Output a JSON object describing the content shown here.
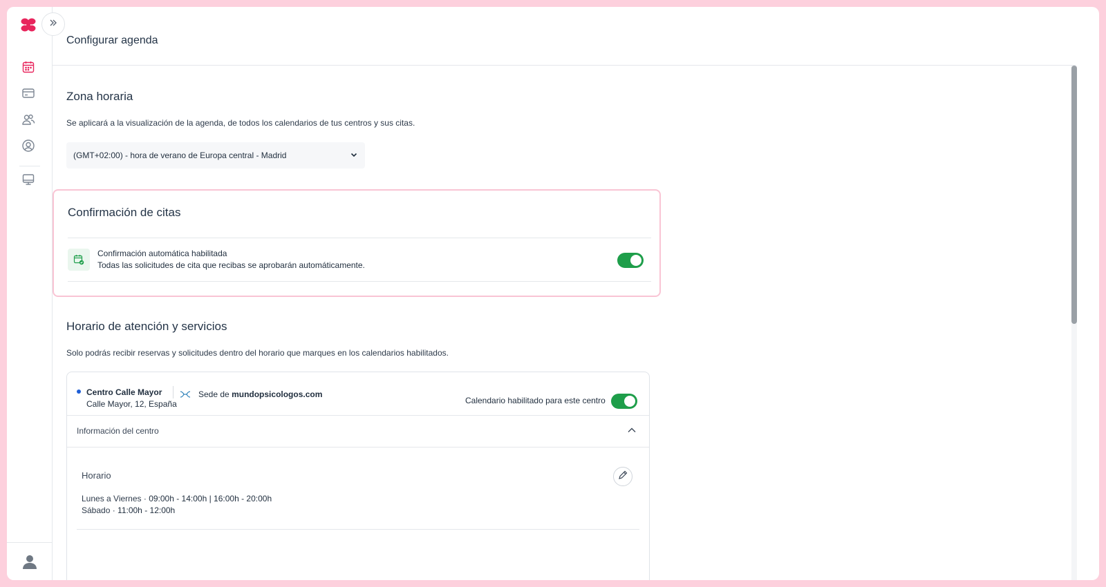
{
  "app": {
    "accent_color": "#e8245c",
    "toggle_color": "#1e9e4a"
  },
  "sidebar": {
    "expand_icon": "chevrons-right-icon",
    "items": [
      {
        "name": "calendar",
        "icon": "calendar-icon",
        "active": true
      },
      {
        "name": "payments",
        "icon": "credit-card-icon",
        "active": false
      },
      {
        "name": "patients",
        "icon": "users-icon",
        "active": false
      },
      {
        "name": "profile",
        "icon": "user-circle-icon",
        "active": false
      },
      {
        "name": "website",
        "icon": "monitor-icon",
        "active": false
      }
    ],
    "bottom_icon": "avatar-icon"
  },
  "header": {
    "title": "Configurar agenda"
  },
  "timezone": {
    "title": "Zona horaria",
    "description": "Se aplicará a la visualización de la agenda, de todos los calendarios de tus centros y sus citas.",
    "selected": "(GMT+02:00) - hora de verano de Europa central - Madrid"
  },
  "confirmation": {
    "title": "Confirmación de citas",
    "label": "Confirmación automática habilitada",
    "description": "Todas las solicitudes de cita que recibas se aprobarán automáticamente.",
    "enabled": true
  },
  "schedule": {
    "title": "Horario de atención y servicios",
    "description": "Solo podrás recibir reservas y solicitudes dentro del horario que marques en los calendarios habilitados.",
    "center": {
      "name": "Centro Calle Mayor",
      "address": "Calle Mayor, 12, España",
      "sede_prefix": "Sede de",
      "sede_site": "mundopsicologos.com",
      "calendar_label": "Calendario habilitado para este centro",
      "calendar_enabled": true,
      "info_label": "Información del centro",
      "horario_title": "Horario",
      "hours": [
        {
          "days": "Lunes a Viernes ·",
          "times": "09:00h - 14:00h | 16:00h - 20:00h"
        },
        {
          "days": "Sábado ·",
          "times": "11:00h - 12:00h"
        }
      ]
    }
  }
}
